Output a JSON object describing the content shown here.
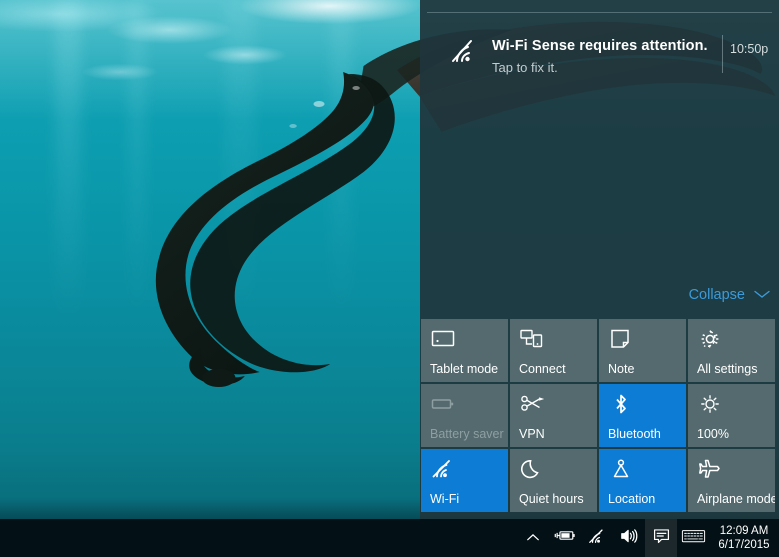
{
  "desktop": {
    "wallpaper_alt": "underwater-freediver-photo",
    "water_color_top": "#1fa9b8",
    "water_color_bottom": "#096f7d"
  },
  "action_center": {
    "background": "#1f363c",
    "accent": "#0c7cd5",
    "link_color": "#3c9ad8",
    "notifications": [
      {
        "icon": "wifi-sense-icon",
        "title": "Wi-Fi Sense requires attention.",
        "subtitle": "Tap to fix it.",
        "time": "10:50p"
      }
    ],
    "collapse": {
      "label": "Collapse",
      "chevron": "chevron-down-icon"
    },
    "quick_actions": [
      {
        "id": "tablet-mode",
        "icon": "tablet-mode-icon",
        "label": "Tablet mode",
        "state": "off"
      },
      {
        "id": "connect",
        "icon": "connect-icon",
        "label": "Connect",
        "state": "off"
      },
      {
        "id": "note",
        "icon": "note-icon",
        "label": "Note",
        "state": "off"
      },
      {
        "id": "all-settings",
        "icon": "gear-icon",
        "label": "All settings",
        "state": "off"
      },
      {
        "id": "battery-saver",
        "icon": "battery-icon",
        "label": "Battery saver",
        "state": "disabled"
      },
      {
        "id": "vpn",
        "icon": "vpn-icon",
        "label": "VPN",
        "state": "off"
      },
      {
        "id": "bluetooth",
        "icon": "bluetooth-icon",
        "label": "Bluetooth",
        "state": "on"
      },
      {
        "id": "brightness",
        "icon": "brightness-icon",
        "label": "100%",
        "state": "off"
      },
      {
        "id": "wifi",
        "icon": "wifi-icon",
        "label": "Wi-Fi",
        "state": "on"
      },
      {
        "id": "quiet-hours",
        "icon": "moon-icon",
        "label": "Quiet hours",
        "state": "off"
      },
      {
        "id": "location",
        "icon": "location-icon",
        "label": "Location",
        "state": "on"
      },
      {
        "id": "airplane-mode",
        "icon": "airplane-icon",
        "label": "Airplane mode",
        "state": "off"
      }
    ]
  },
  "taskbar": {
    "background": "#031015",
    "tray_icons": [
      {
        "id": "show-hidden-icons",
        "icon": "chevron-up-icon",
        "active": false
      },
      {
        "id": "battery",
        "icon": "battery-charging-icon",
        "active": false
      },
      {
        "id": "network",
        "icon": "wifi-icon",
        "active": false
      },
      {
        "id": "volume",
        "icon": "speaker-icon",
        "active": false
      },
      {
        "id": "action-center",
        "icon": "action-center-icon",
        "active": true
      },
      {
        "id": "touch-keyboard",
        "icon": "keyboard-icon",
        "active": false
      }
    ],
    "clock": {
      "time": "12:09 AM",
      "date": "6/17/2015"
    }
  }
}
